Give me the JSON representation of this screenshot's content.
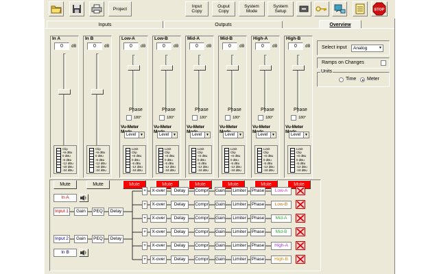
{
  "toolbar": {
    "project": "Project",
    "input_copy": "Input\nCopy",
    "output_copy": "Ouput\nCopy",
    "system_mode": "System\nMode",
    "system_setup": "System\nSetup",
    "stop": "STOP"
  },
  "tabs": [
    {
      "label": "Inputs",
      "active": false
    },
    {
      "label": "Outputs",
      "active": false
    },
    {
      "label": "Overview",
      "active": true
    }
  ],
  "inputs": [
    {
      "name": "In A",
      "value": "0",
      "unit": "dB",
      "mute": "Mute",
      "muted": false,
      "fader_level": 0.63
    },
    {
      "name": "In B",
      "value": "0",
      "unit": "dB",
      "mute": "Mute",
      "muted": false,
      "fader_level": 0.63
    }
  ],
  "outputs": [
    {
      "name": "Low-A",
      "value": "0",
      "unit": "dB",
      "phase": "Phase",
      "phase_opt": "180°",
      "vu_title": "Vu-Meter Mode",
      "vu_mode": "Level",
      "mute": "Mute",
      "muted": true,
      "fader_level": 0.8
    },
    {
      "name": "Low-B",
      "value": "0",
      "unit": "dB",
      "phase": "Phase",
      "phase_opt": "180°",
      "vu_title": "Vu-Meter Mode",
      "vu_mode": "Level",
      "mute": "Mute",
      "muted": true,
      "fader_level": 0.8
    },
    {
      "name": "Mid-A",
      "value": "0",
      "unit": "dB",
      "phase": "Phase",
      "phase_opt": "180°",
      "vu_title": "Vu-Meter Mode",
      "vu_mode": "Level",
      "mute": "Mute",
      "muted": true,
      "fader_level": 0.8
    },
    {
      "name": "Mid-B",
      "value": "0",
      "unit": "dB",
      "phase": "Phase",
      "phase_opt": "180°",
      "vu_title": "Vu-Meter Mode",
      "vu_mode": "Level",
      "mute": "Mute",
      "muted": true,
      "fader_level": 0.8
    },
    {
      "name": "High-A",
      "value": "0",
      "unit": "dB",
      "phase": "Phase",
      "phase_opt": "180°",
      "vu_title": "Vu-Meter Mode",
      "vu_mode": "Level",
      "mute": "Mute",
      "muted": true,
      "fader_level": 0.8
    },
    {
      "name": "High-B",
      "value": "0",
      "unit": "dB",
      "phase": "Phase",
      "phase_opt": "180°",
      "vu_title": "Vu-Meter Mode",
      "vu_mode": "Level",
      "mute": "Mute",
      "muted": true,
      "fader_level": 0.8
    }
  ],
  "input_meter_labels": [
    "Clip",
    "+6 dBu",
    "0 dBu",
    "-6 dBu",
    "-12 dBu",
    "-18 dBu",
    "-24 dBu"
  ],
  "output_meter_labels": [
    "Limit",
    "Clip",
    "+6 dBu",
    "0 dBu",
    "-6 dBu",
    "-12 dBu",
    "-18 dBu"
  ],
  "overview": {
    "select_input_label": "Select input",
    "select_input_value": "Analog",
    "ramps_label": "Ramps on Changes",
    "units_label": "Units",
    "unit_time": "Time",
    "unit_meter": "Meter",
    "selected_unit": "Meter"
  },
  "diagram": {
    "in_a": "In A",
    "in_b": "In B",
    "input1": "Input 1",
    "input2": "Input 2",
    "gain": "Gain",
    "peq": "PEQ",
    "delay": "Delay",
    "plus": "+",
    "chain": [
      "X-over",
      "Delay",
      "Compr",
      "Gain",
      "Limiter",
      "Phase"
    ],
    "outputs": [
      {
        "name": "Low-A",
        "color": "#cc33cc"
      },
      {
        "name": "Low-B",
        "color": "#cc6600"
      },
      {
        "name": "Mid-A",
        "color": "#33aa33"
      },
      {
        "name": "Mid-B",
        "color": "#33aa33"
      },
      {
        "name": "High-A",
        "color": "#9933cc"
      },
      {
        "name": "High-B",
        "color": "#cc8800"
      }
    ]
  },
  "colors": {
    "mute_on": "#ff0000",
    "panel": "#ece9d8",
    "input_label": "#cc0000",
    "input_b_label": "#000080"
  }
}
